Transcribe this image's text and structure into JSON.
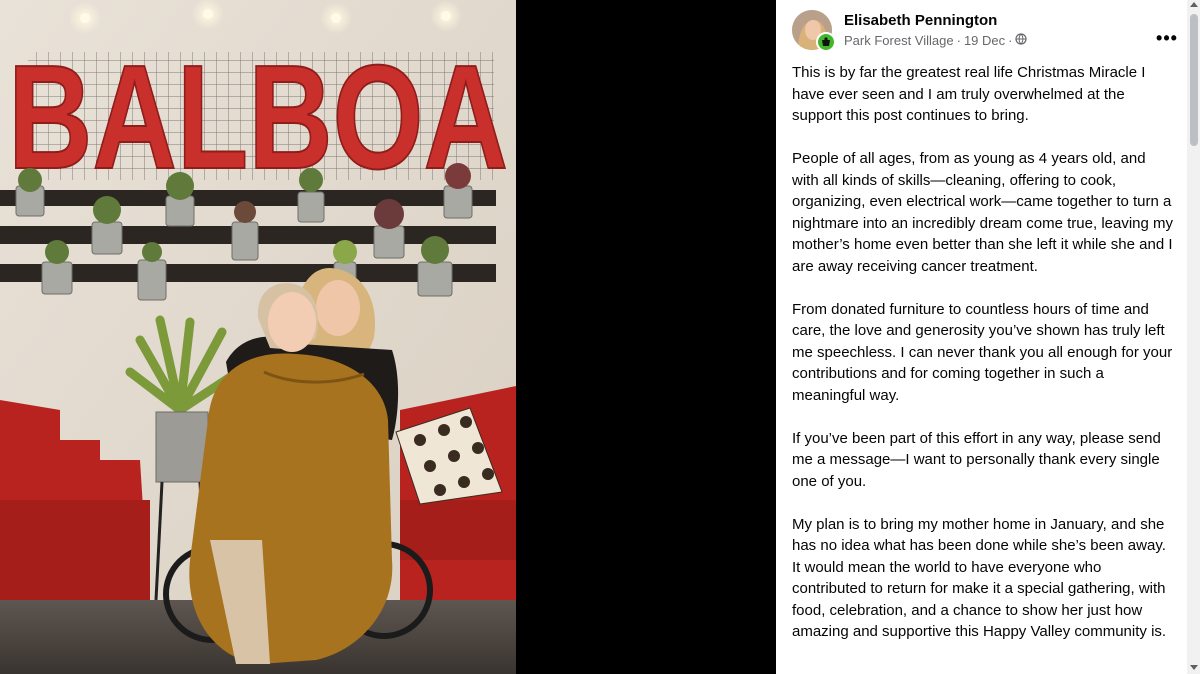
{
  "post": {
    "author": "Elisabeth Pennington",
    "location": "Park Forest Village",
    "date": "19 Dec",
    "separator": "·",
    "more_label": "•••",
    "paragraphs": [
      "This is by far the greatest real life Christmas Miracle I have ever seen and I am truly overwhelmed at the support this post continues to bring.",
      "People of all ages, from as young as 4 years old, and with all kinds of skills—cleaning, offering to cook, organizing, even electrical work—came together to turn a nightmare into an incredibly dream come true, leaving my mother’s home even better than she left it while she and I are away receiving cancer treatment.",
      "From donated furniture to countless hours of time and care, the love and generosity you’ve shown has truly left me speechless. I can never thank you all enough for your contributions and for coming together in such a meaningful way.",
      "If you’ve been part of this effort in any way, please send me a message—I want to personally thank every single one of you.",
      "My plan is to bring my mother home in January, and she has no idea what has been done while she’s been away. It would mean the world to have everyone who contributed to return for make it a special gathering, with food, celebration, and a chance to show her just how amazing and supportive this Happy Valley community is."
    ]
  },
  "photo": {
    "sign_text": "BALBOA"
  },
  "icons": {
    "privacy": "globe-icon",
    "badge": "group-badge-icon",
    "more": "more-options-icon"
  },
  "colors": {
    "sign_red": "#c9302c",
    "text": "#050505",
    "meta": "#65676b",
    "badge_green": "#42b72a"
  }
}
